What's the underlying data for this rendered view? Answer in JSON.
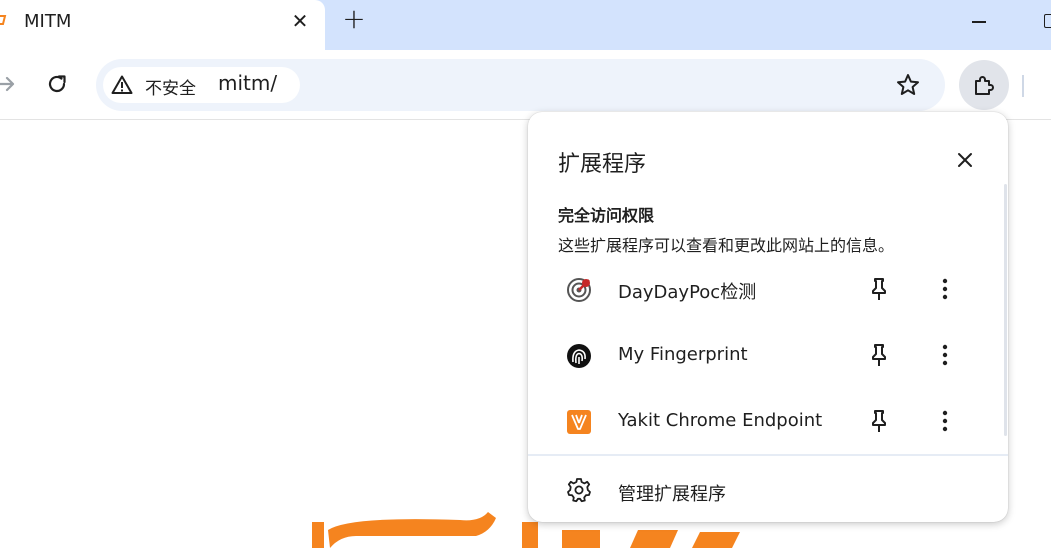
{
  "tab": {
    "title": "MITM",
    "close_icon": "close-icon",
    "favicon": "yakit-tab-icon"
  },
  "window_controls": {
    "new_tab_symbol": "+",
    "minimize_icon": "minimize-icon",
    "maximize_icon": "maximize-icon"
  },
  "toolbar": {
    "security_label": "不安全",
    "url": "mitm/",
    "icons": [
      "forward-icon",
      "reload-icon",
      "warning-icon",
      "star-icon",
      "puzzle-icon"
    ]
  },
  "extensions_popup": {
    "title": "扩展程序",
    "section_title": "完全访问权限",
    "section_desc": "这些扩展程序可以查看和更改此网站上的信息。",
    "items": [
      {
        "name": "DayDayPoc检测",
        "icon": "daydaypoc-icon"
      },
      {
        "name": "My Fingerprint",
        "icon": "fingerprint-icon"
      },
      {
        "name": "Yakit Chrome Endpoint",
        "icon": "yakit-icon"
      }
    ],
    "manage_label": "管理扩展程序"
  },
  "colors": {
    "tabstrip": "#d3e3fd",
    "omnibox": "#eef3fb",
    "accent_orange": "#f5841f",
    "daydaypoc_red": "#c62828"
  }
}
